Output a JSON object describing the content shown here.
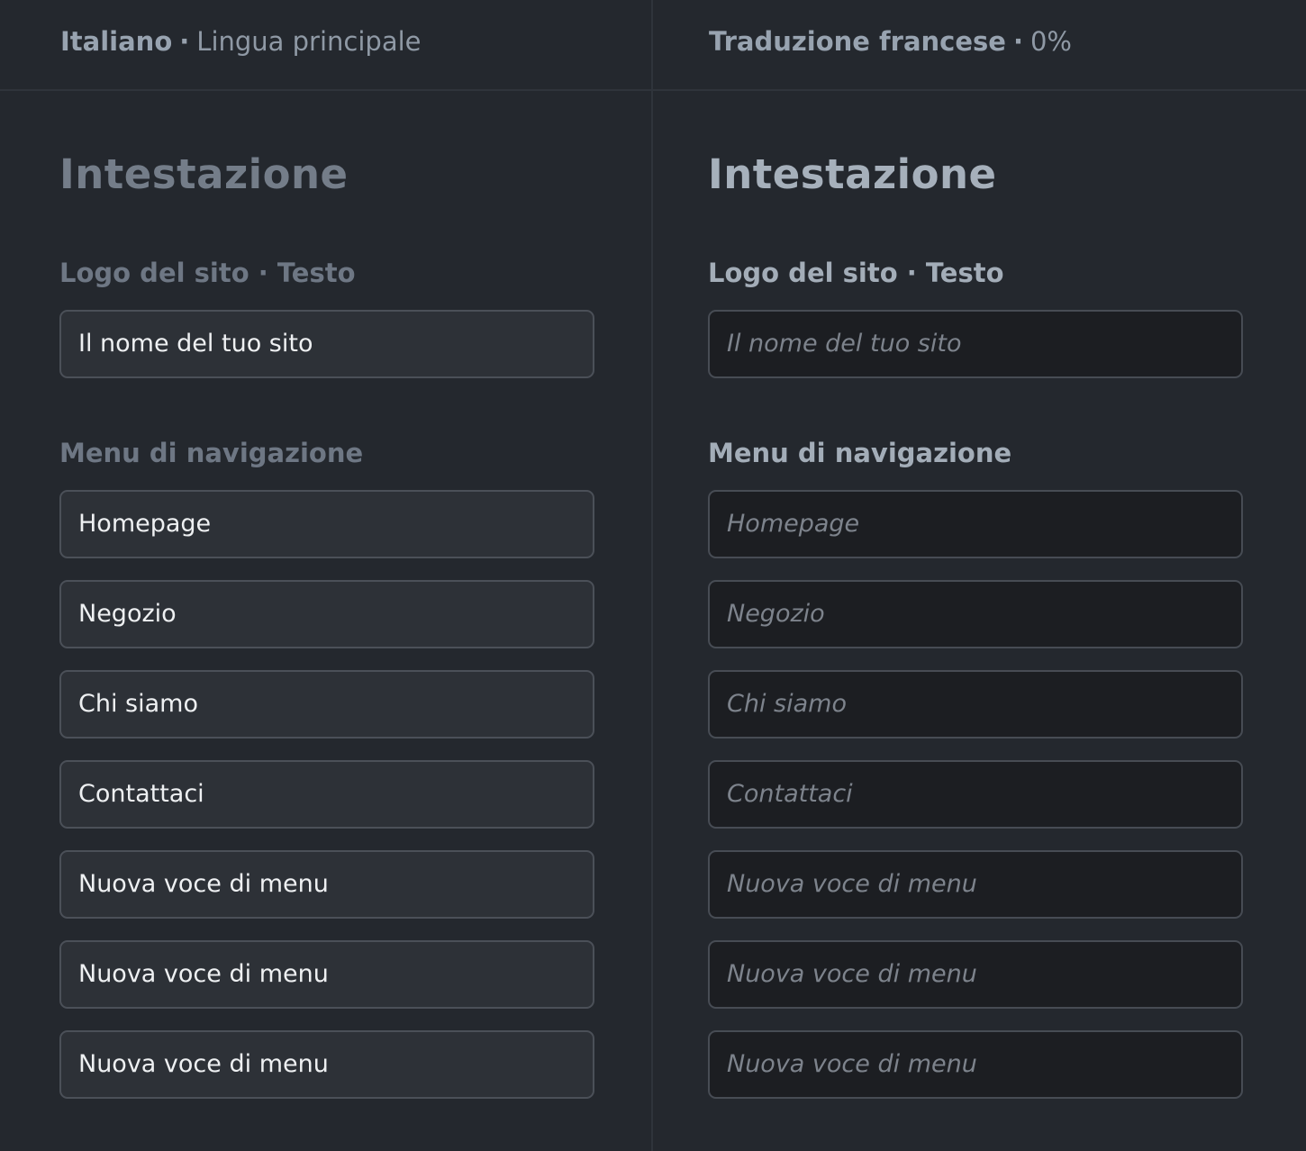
{
  "left": {
    "header": {
      "language": "Italiano",
      "separator": "·",
      "note": "Lingua principale"
    },
    "section_title": "Intestazione",
    "logo_label": "Logo del sito · Testo",
    "logo_value": "Il nome del tuo sito",
    "menu_label": "Menu di navigazione",
    "menu_items": [
      "Homepage",
      "Negozio",
      "Chi siamo",
      "Contattaci",
      "Nuova voce di menu",
      "Nuova voce di menu",
      "Nuova voce di menu"
    ]
  },
  "right": {
    "header": {
      "language": "Traduzione francese",
      "separator": "·",
      "note": "0%"
    },
    "section_title": "Intestazione",
    "logo_label": "Logo del sito · Testo",
    "logo_placeholder": "Il nome del tuo sito",
    "menu_label": "Menu di navigazione",
    "menu_placeholders": [
      "Homepage",
      "Negozio",
      "Chi siamo",
      "Contattaci",
      "Nuova voce di menu",
      "Nuova voce di menu",
      "Nuova voce di menu"
    ]
  },
  "colors": {
    "background": "#24282e",
    "source_field_bg": "#2d3137",
    "target_field_bg": "#1c1e22",
    "border": "#4b5058"
  }
}
